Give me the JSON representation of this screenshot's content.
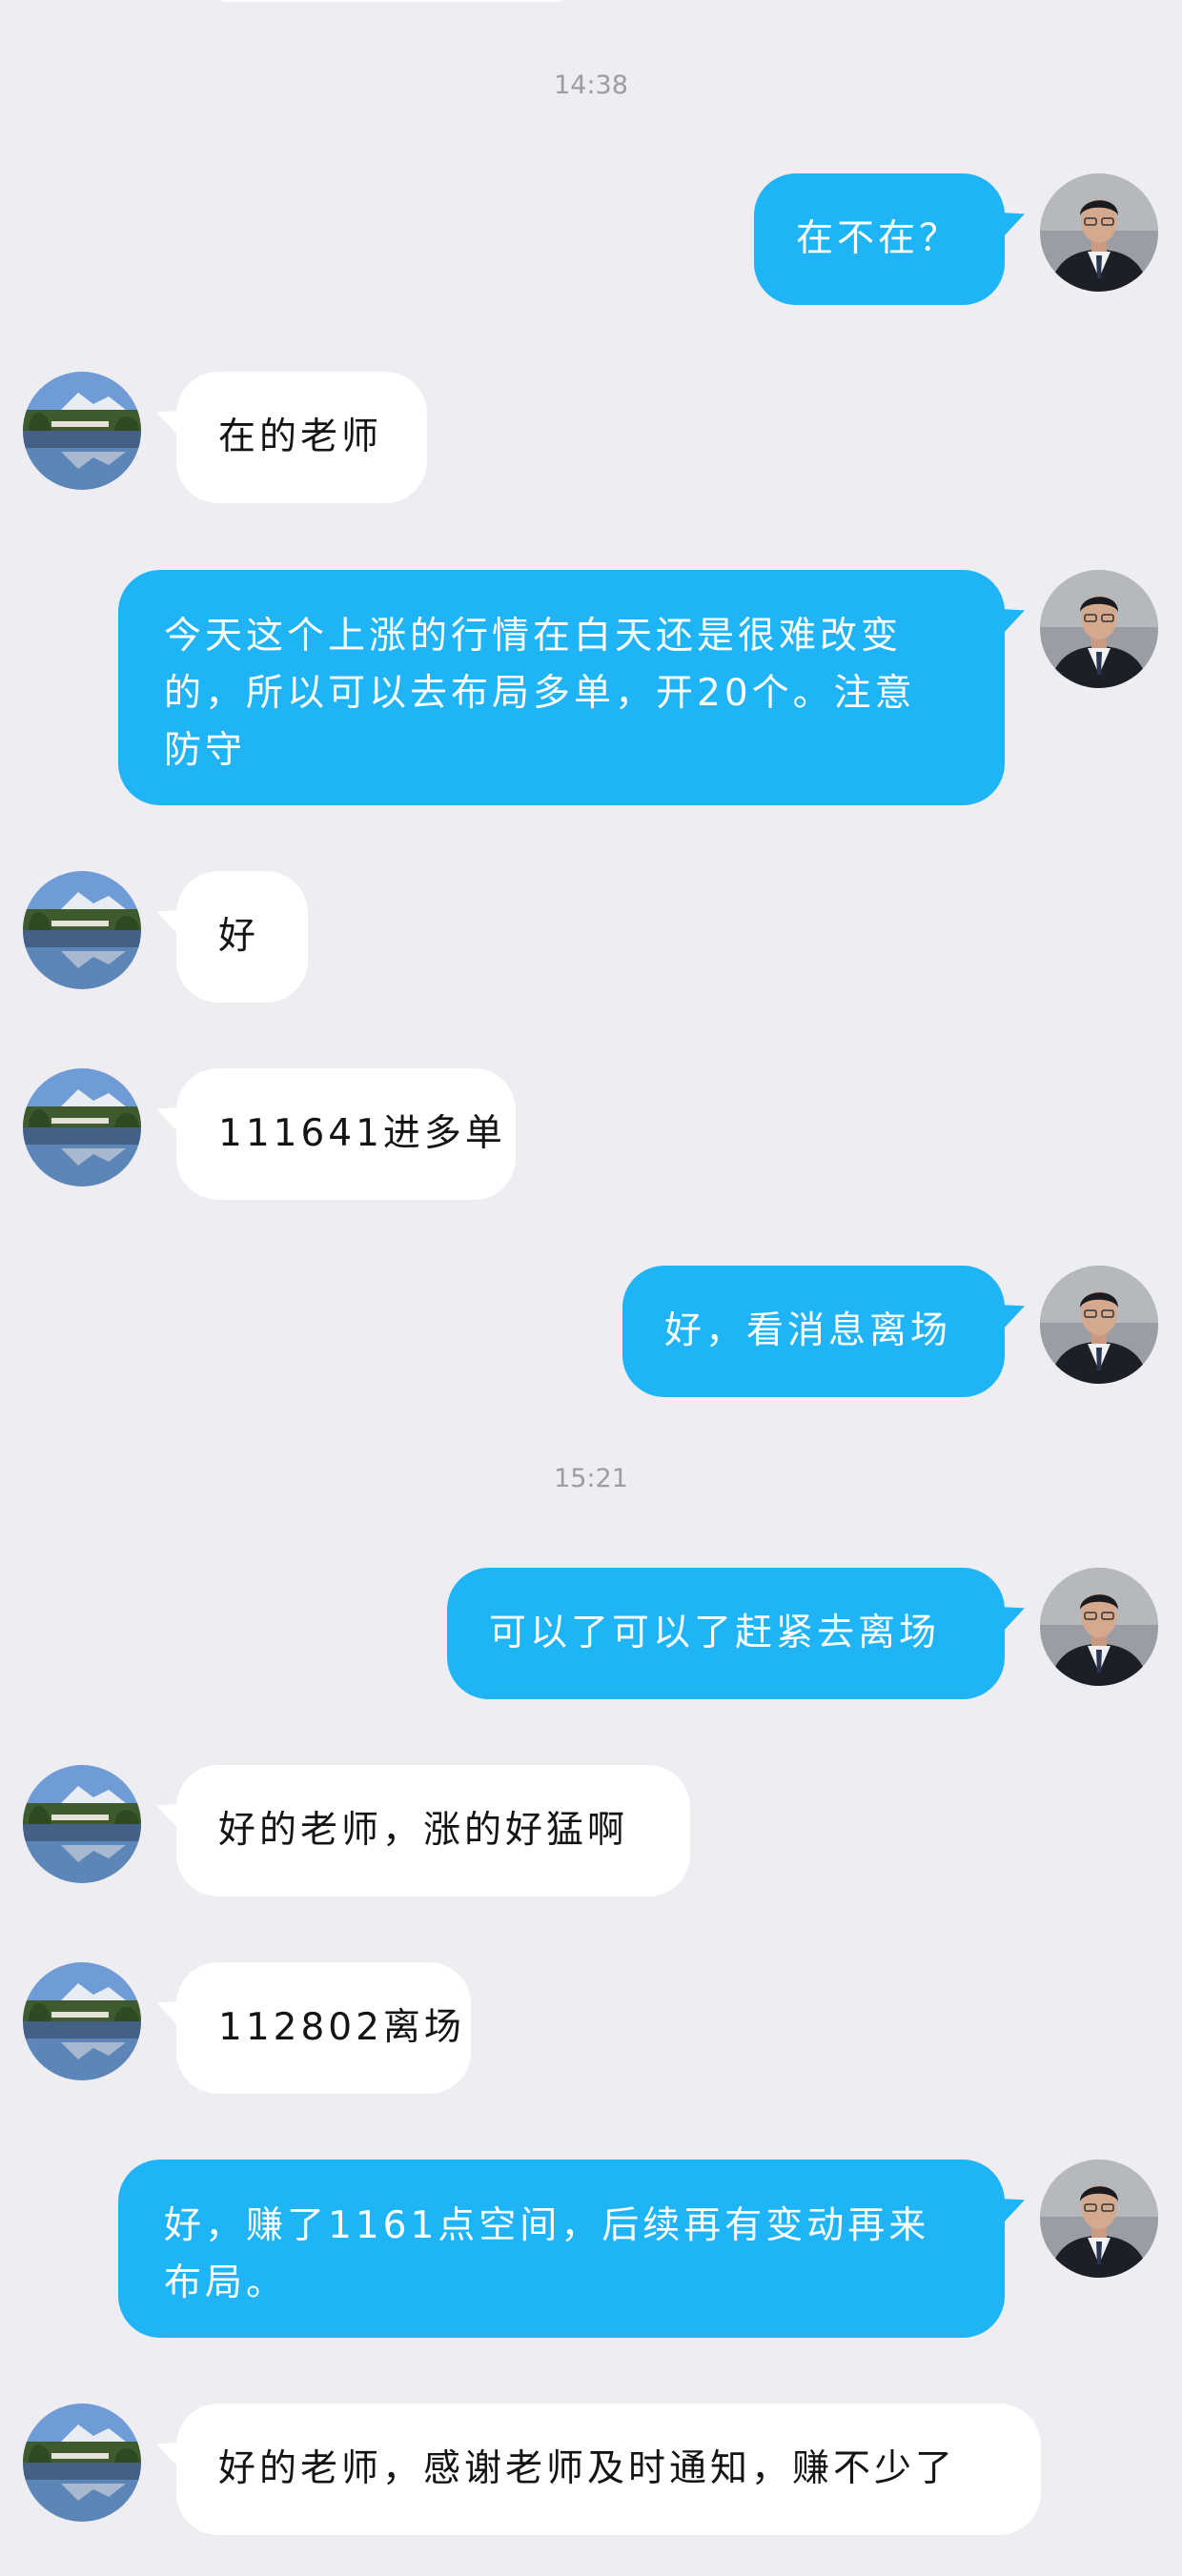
{
  "timestamps": [
    "14:38",
    "15:21"
  ],
  "colors": {
    "background": "#ededf2",
    "outgoing_bubble": "#1fb4f6",
    "incoming_bubble": "#ffffff",
    "timestamp_text": "#9c9ca2"
  },
  "avatars": {
    "teacher": "man-in-suit-avatar (blurred photo)",
    "student": "lake-landscape-avatar"
  },
  "messages": [
    {
      "sender": "teacher",
      "text": "在不在？"
    },
    {
      "sender": "student",
      "text": "在的老师"
    },
    {
      "sender": "teacher",
      "text": "今天这个上涨的行情在白天还是很难改变的，所以可以去布局多单，开20个。注意防守"
    },
    {
      "sender": "student",
      "text": "好"
    },
    {
      "sender": "student",
      "text": "111641进多单"
    },
    {
      "sender": "teacher",
      "text": "好，看消息离场"
    },
    {
      "sender": "teacher",
      "text": "可以了可以了赶紧去离场"
    },
    {
      "sender": "student",
      "text": "好的老师，涨的好猛啊"
    },
    {
      "sender": "student",
      "text": "112802离场"
    },
    {
      "sender": "teacher",
      "text": "好，赚了1161点空间，后续再有变动再来布局。"
    },
    {
      "sender": "student",
      "text": "好的老师，感谢老师及时通知，赚不少了"
    }
  ]
}
